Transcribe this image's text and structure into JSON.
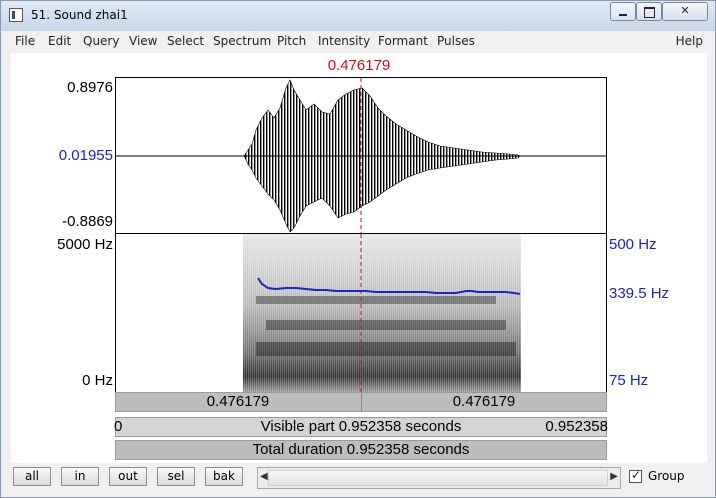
{
  "window": {
    "title": "51. Sound zhai1"
  },
  "menu": [
    "File",
    "Edit",
    "Query",
    "View",
    "Select",
    "Spectrum",
    "Pitch",
    "Intensity",
    "Formant",
    "Pulses"
  ],
  "help": "Help",
  "cursor": {
    "time": "0.476179"
  },
  "waveform": {
    "max": "0.8976",
    "mid": "0.01955",
    "min": "-0.8869"
  },
  "spectrogram": {
    "top": "5000 Hz",
    "bottom": "0 Hz"
  },
  "pitch": {
    "top": "500 Hz",
    "current": "339.5 Hz",
    "bottom": "75 Hz"
  },
  "bars": {
    "left_time": "0.476179",
    "right_time": "0.476179",
    "visible_start": "0",
    "visible_label": "Visible part 0.952358 seconds",
    "visible_end": "0.952358",
    "total_label": "Total duration 0.952358 seconds"
  },
  "buttons": {
    "all": "all",
    "in": "in",
    "out": "out",
    "sel": "sel",
    "bak": "bak"
  },
  "group": {
    "label": "Group",
    "checked": true
  },
  "colors": {
    "pitch": "#1a23c8",
    "cursor": "#d01010"
  }
}
